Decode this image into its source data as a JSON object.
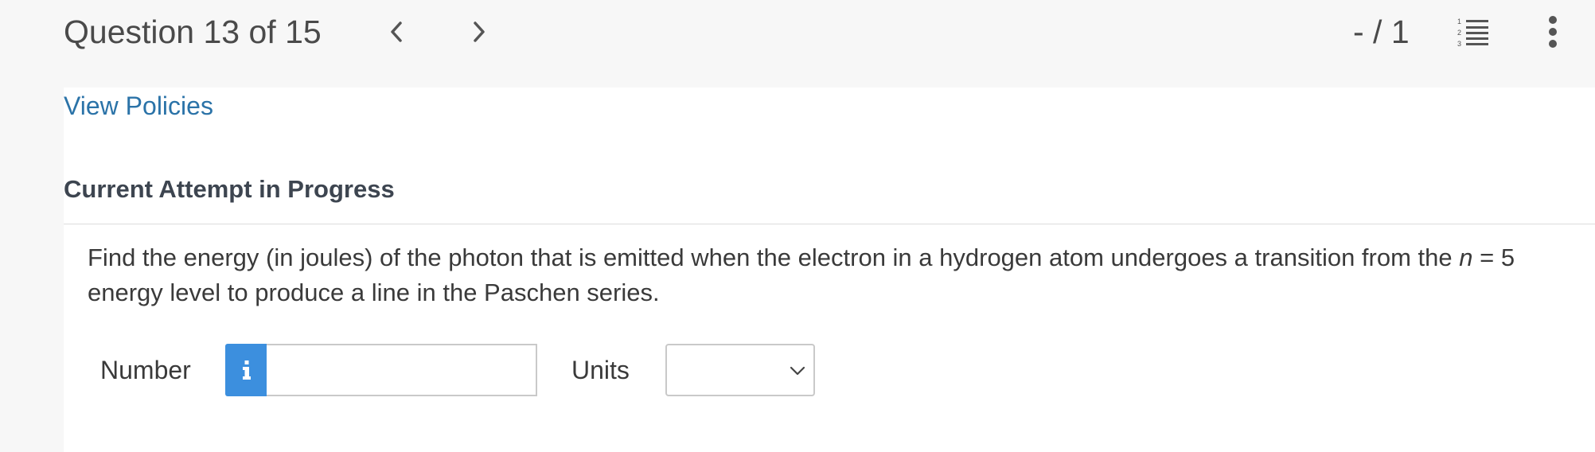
{
  "header": {
    "question_counter": "Question 13 of 15",
    "score": "- / 1"
  },
  "policies_link": "View Policies",
  "attempt_heading": "Current Attempt in Progress",
  "question": {
    "text_before": "Find the energy (in joules) of the photon that is emitted when the electron in a hydrogen atom undergoes a transition from the ",
    "variable": "n",
    "text_after": " = 5 energy level to produce a line in the Paschen series."
  },
  "answer": {
    "number_label": "Number",
    "number_value": "",
    "units_label": "Units",
    "units_selected": ""
  },
  "colors": {
    "link": "#2b73a8",
    "info_button": "#3c8fde",
    "header_bg": "#f7f7f7"
  },
  "icons": {
    "prev": "chevron-left-icon",
    "next": "chevron-right-icon",
    "list": "numbered-list-icon",
    "more": "vertical-ellipsis-icon",
    "info": "info-icon",
    "dropdown": "chevron-down-icon"
  }
}
